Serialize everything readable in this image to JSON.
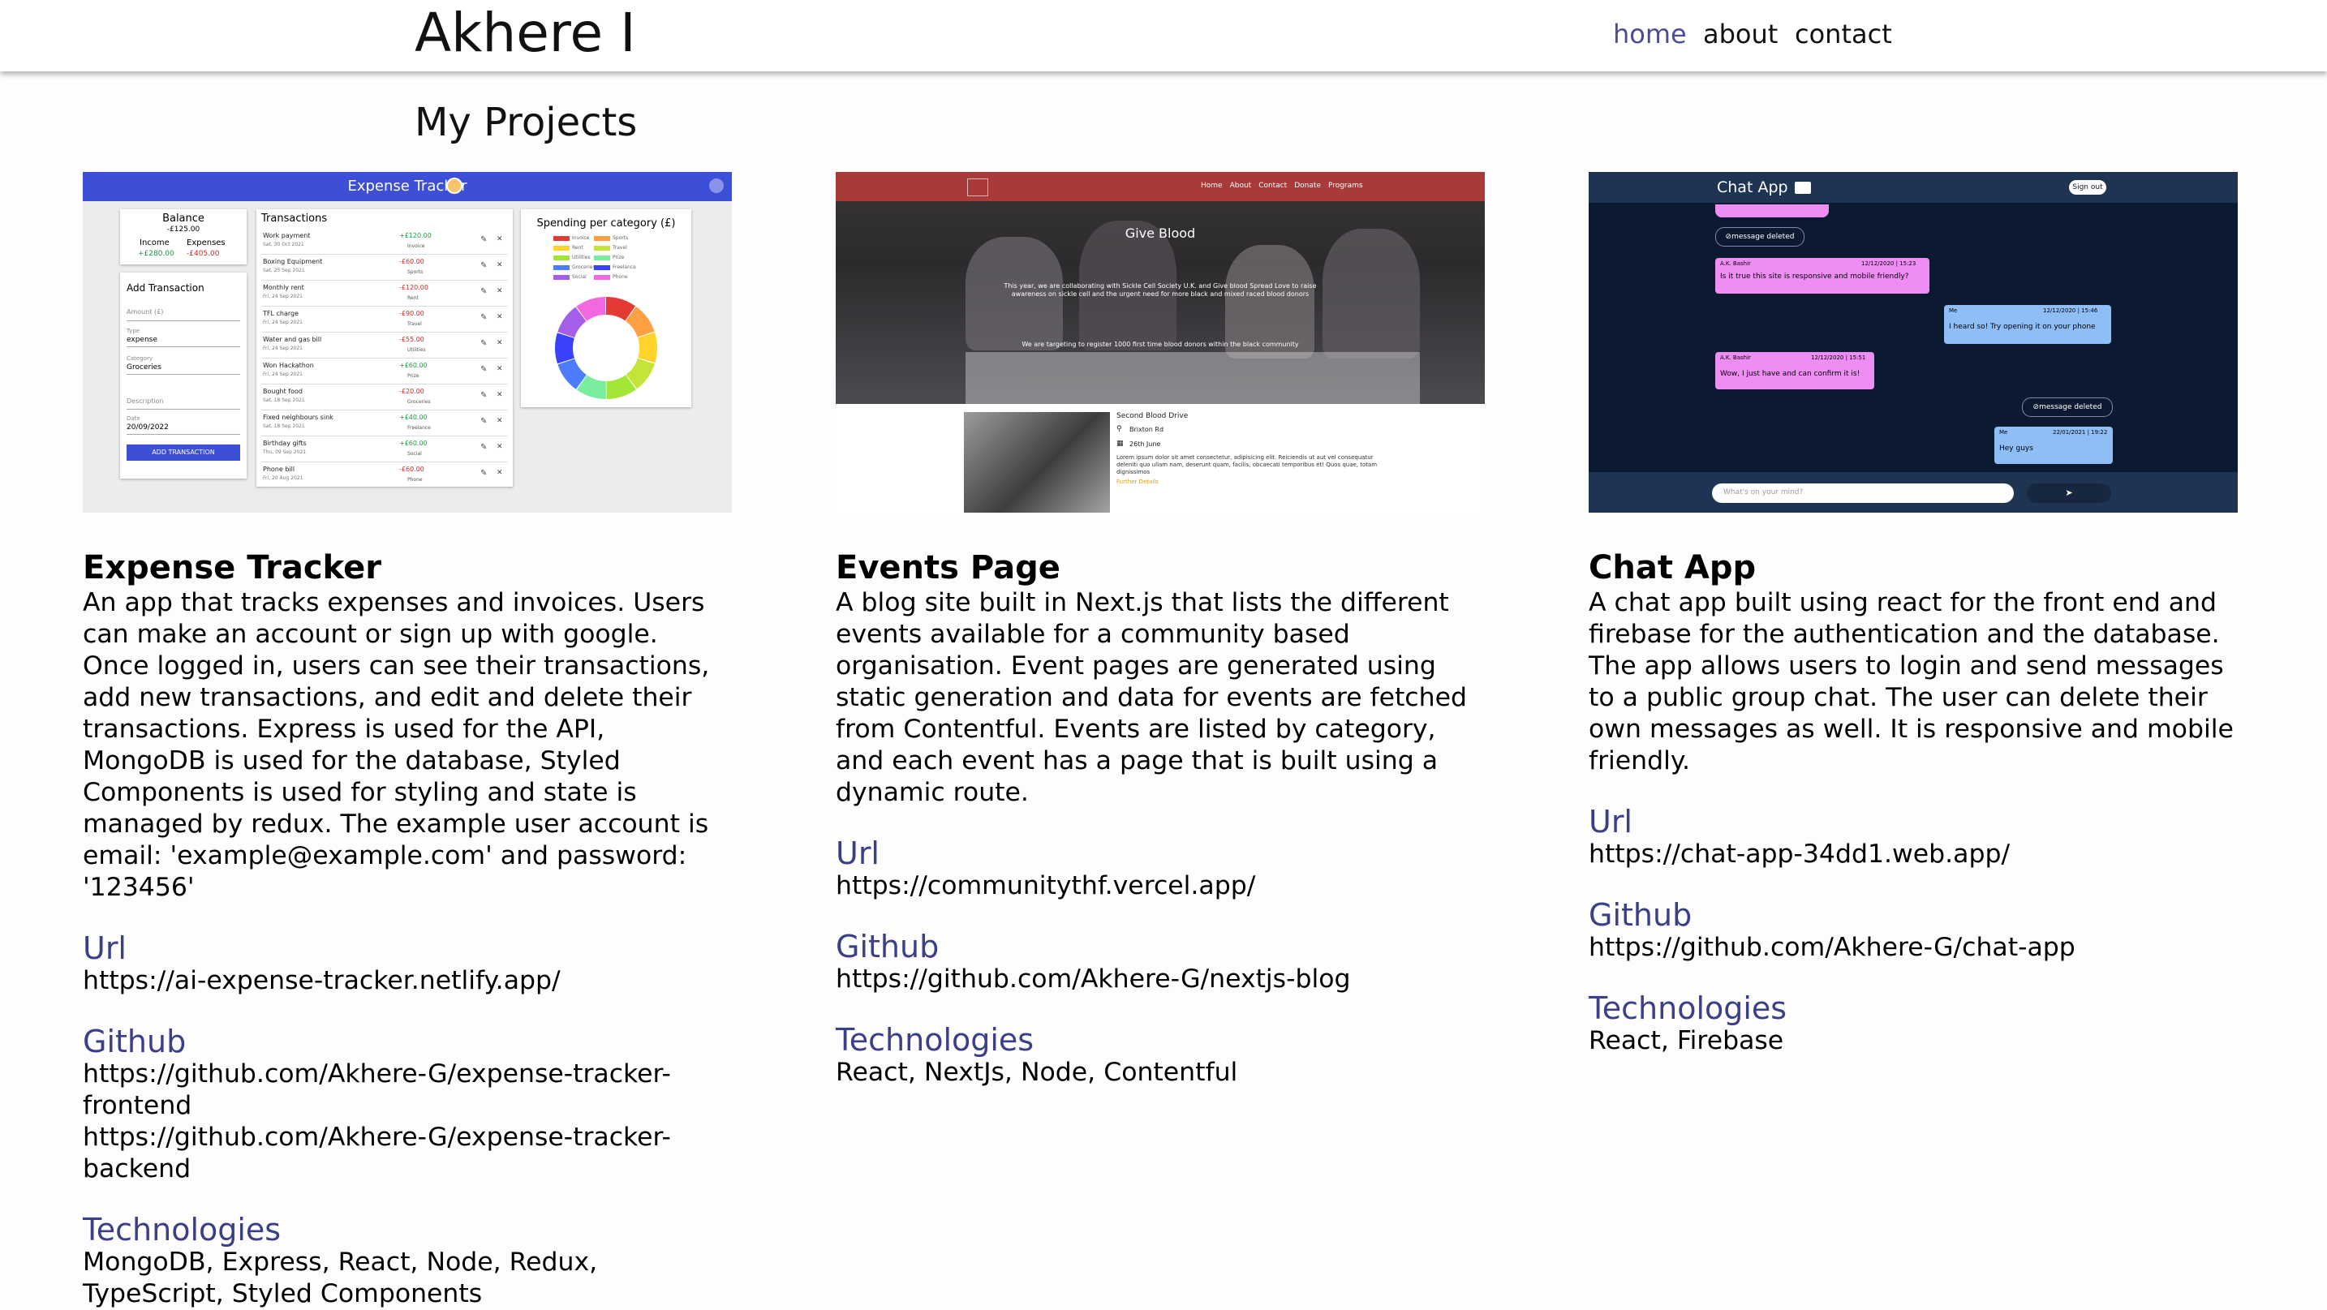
{
  "header": {
    "brand": "Akhere I",
    "nav": [
      {
        "label": "home",
        "active": true
      },
      {
        "label": "about"
      },
      {
        "label": "contact"
      }
    ]
  },
  "page_title": "My Projects",
  "projects": [
    {
      "title": "Expense Tracker",
      "description": "An app that tracks expenses and invoices. Users can make an account or sign up with google. Once logged in, users can see their transactions, add new transactions, and edit and delete their transactions. Express is used for the API, MongoDB is used for the database, Styled Components is used for styling and state is managed by redux. The example user account is email: 'example@example.com' and password: '123456'",
      "url_label": "Url",
      "urls": [
        "https://ai-expense-tracker.netlify.app/"
      ],
      "github_label": "Github",
      "githubs": [
        "https://github.com/Akhere-G/expense-tracker-frontend",
        "https://github.com/Akhere-G/expense-tracker-backend"
      ],
      "tech_label": "Technologies",
      "tech": "MongoDB, Express, React, Node, Redux, TypeScript, Styled Components",
      "screenshot": {
        "app_title": "Expense Tracker",
        "balance_label": "Balance",
        "balance_value": "-£125.00",
        "income_label": "Income",
        "income_value": "+£280.00",
        "expenses_label": "Expenses",
        "expenses_value": "-£405.00",
        "add_title": "Add Transaction",
        "amount_label": "Amount (£)",
        "type_label": "Type",
        "type_value": "expense",
        "category_label": "Category",
        "category_value": "Groceries",
        "description_label": "Description",
        "date_label": "Date",
        "date_value": "20/09/2022",
        "add_button": "ADD TRANSACTION",
        "transactions_title": "Transactions",
        "transactions": [
          {
            "name": "Work payment",
            "date": "Sat, 30 Oct 2021",
            "amount": "+£120.00",
            "cat": "Invoice",
            "pos": true
          },
          {
            "name": "Boxing Equipment",
            "date": "Sat, 25 Sep 2021",
            "amount": "-£60.00",
            "cat": "Sports",
            "pos": false
          },
          {
            "name": "Monthly rent",
            "date": "Fri, 24 Sep 2021",
            "amount": "-£120.00",
            "cat": "Rent",
            "pos": false
          },
          {
            "name": "TFL charge",
            "date": "Fri, 24 Sep 2021",
            "amount": "-£90.00",
            "cat": "Travel",
            "pos": false
          },
          {
            "name": "Water and gas bill",
            "date": "Fri, 24 Sep 2021",
            "amount": "-£55.00",
            "cat": "Utilities",
            "pos": false
          },
          {
            "name": "Won Hackathon",
            "date": "Fri, 24 Sep 2021",
            "amount": "+£60.00",
            "cat": "Prize",
            "pos": true
          },
          {
            "name": "Bought food",
            "date": "Sat, 18 Sep 2021",
            "amount": "-£20.00",
            "cat": "Groceries",
            "pos": false
          },
          {
            "name": "Fixed neighbours sink",
            "date": "Sat, 18 Sep 2021",
            "amount": "+£40.00",
            "cat": "Freelance",
            "pos": true
          },
          {
            "name": "Birthday gifts",
            "date": "Thu, 09 Sep 2021",
            "amount": "+£60.00",
            "cat": "Social",
            "pos": true
          },
          {
            "name": "Phone bill",
            "date": "Fri, 20 Aug 2021",
            "amount": "-£60.00",
            "cat": "Phone",
            "pos": false
          }
        ],
        "chart_title": "Spending per category (£)",
        "legend": [
          {
            "label": "Invoice",
            "color": "#e53935"
          },
          {
            "label": "Sports",
            "color": "#ff9f43"
          },
          {
            "label": "Rent",
            "color": "#ffd32a"
          },
          {
            "label": "Travel",
            "color": "#c4e538"
          },
          {
            "label": "Utilities",
            "color": "#a3e635"
          },
          {
            "label": "Prize",
            "color": "#7bed9f"
          },
          {
            "label": "Groceries",
            "color": "#4d7cfe"
          },
          {
            "label": "Freelance",
            "color": "#3742fa"
          },
          {
            "label": "Social",
            "color": "#a55eea"
          },
          {
            "label": "Phone",
            "color": "#f368e0"
          }
        ]
      }
    },
    {
      "title": "Events Page",
      "description": "A blog site built in Next.js that lists the different events available for a community based organisation. Event pages are generated using static generation and data for events are fetched from Contentful. Events are listed by category, and each event has a page that is built using a dynamic route.",
      "url_label": "Url",
      "urls": [
        "https://communitythf.vercel.app/"
      ],
      "github_label": "Github",
      "githubs": [
        "https://github.com/Akhere-G/nextjs-blog"
      ],
      "tech_label": "Technologies",
      "tech": "React, NextJs, Node, Contentful",
      "screenshot": {
        "nav": [
          "Home",
          "About",
          "Contact",
          "Donate",
          "Programs"
        ],
        "hero_title": "Give Blood",
        "hero_text": "This year, we are collaborating with Sickle Cell Society U.K. and Give blood Spread Love to raise awareness on sickle cell and the urgent need for more black and mixed raced blood donors",
        "hero_text2": "We are targeting to register 1000 first time blood donors within the black community",
        "event_title": "Second Blood Drive",
        "event_place": "Brixton Rd",
        "event_date": "26th June",
        "event_desc": "Lorem ipsum dolor sit amet consectetur, adipisicing elit. Reiciendis ut aut vel consequatur deleniti quo ullam nam, deserunt quam, facilis, obcaecati temporibus et! Quos quae, totam dignissimos",
        "event_link": "Further Details"
      }
    },
    {
      "title": "Chat App",
      "description": "A chat app built using react for the front end and firebase for the authentication and the database. The app allows users to login and send messages to a public group chat. The user can delete their own messages as well. It is responsive and mobile friendly.",
      "url_label": "Url",
      "urls": [
        "https://chat-app-34dd1.web.app/"
      ],
      "github_label": "Github",
      "githubs": [
        "https://github.com/Akhere-G/chat-app"
      ],
      "tech_label": "Technologies",
      "tech": "React, Firebase",
      "screenshot": {
        "app_title": "Chat App",
        "sign_out": "Sign out",
        "deleted_label": "message deleted",
        "msg1_name": "A.K. Bashir",
        "msg1_date": "12/12/2020 | 15:23",
        "msg1_text": "Is it true this site is responsive and mobile friendly?",
        "msg2_name": "Me",
        "msg2_date": "12/12/2020 | 15:46",
        "msg2_text": "I heard so! Try opening it on your phone",
        "msg3_name": "A.K. Bashir",
        "msg3_date": "12/12/2020 | 15:51",
        "msg3_text": "Wow, I just have and can confirm it is!",
        "msg4_name": "Me",
        "msg4_date": "22/01/2021 | 19:22",
        "msg4_text": "Hey guys",
        "input_placeholder": "What's on your mind?",
        "send_icon": "send-arrow"
      }
    }
  ]
}
